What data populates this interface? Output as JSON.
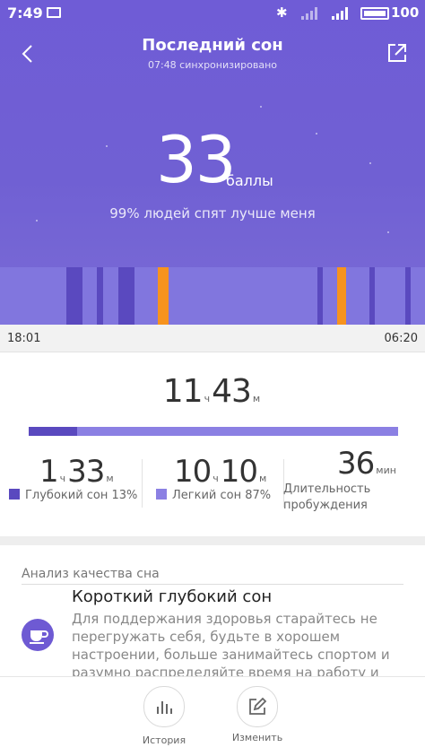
{
  "status_bar": {
    "time": "7:49",
    "battery": "100"
  },
  "header": {
    "title": "Последний сон",
    "sync_text": "07:48 синхронизировано"
  },
  "score": {
    "value": "33",
    "unit": "баллы",
    "comparison": "99% людей спят лучше меня"
  },
  "timeline": {
    "start_time": "18:01",
    "end_time": "06:20"
  },
  "total_sleep": {
    "hours": "11",
    "hours_unit": "ч",
    "minutes": "43",
    "minutes_unit": "м"
  },
  "sleep_ratio": {
    "deep_percent": 13,
    "light_percent": 87
  },
  "stats": {
    "deep": {
      "hours": "1",
      "hours_unit": "ч",
      "minutes": "33",
      "minutes_unit": "м",
      "label": "Глубокий сон 13%",
      "color": "#5a49bf"
    },
    "light": {
      "hours": "10",
      "hours_unit": "ч",
      "minutes": "10",
      "minutes_unit": "м",
      "label": "Легкий сон 87%",
      "color": "#8b80e3"
    },
    "awake": {
      "minutes": "36",
      "minutes_unit": "мин",
      "label_line1": "Длительность",
      "label_line2": "пробуждения"
    }
  },
  "analysis": {
    "header": "Анализ качества сна",
    "title": "Короткий глубокий сон",
    "text": "Для поддержания здоровья старайтесь не перегружать себя, будьте в хорошем настроении, больше занимайтесь спортом и разумно распределяйте время на работу и"
  },
  "bottom_nav": {
    "history_label": "История",
    "edit_label": "Изменить"
  },
  "colors": {
    "accent": "#6f5cd6",
    "deep_sleep": "#5a49bf",
    "light_sleep": "#8176de",
    "awake": "#f7931e"
  },
  "icons": {
    "back": "chevron-left-icon",
    "share": "share-icon",
    "gallery": "gallery-icon",
    "bluetooth": "bluetooth-icon",
    "analysis": "coffee-cup-icon",
    "history": "bar-chart-icon",
    "edit": "edit-icon"
  }
}
